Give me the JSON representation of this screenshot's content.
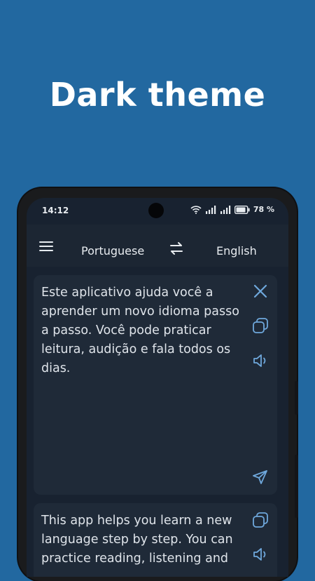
{
  "hero": {
    "title": "Dark theme"
  },
  "status_bar": {
    "time": "14:12",
    "battery": "78 %"
  },
  "app_bar": {
    "source_language": "Portuguese",
    "target_language": "English"
  },
  "source_card": {
    "text": "Este aplicativo ajuda você a aprender um novo idioma passo a passo. Você pode praticar leitura, audição e fala todos os dias."
  },
  "result_card": {
    "text": "This app helps you learn a new language step by step. You can practice reading, listening and"
  },
  "icons": {
    "clear": "close-icon",
    "copy": "copy-icon",
    "speak": "speaker-icon",
    "send": "send-icon",
    "swap": "swap-icon",
    "menu": "hamburger-menu-icon"
  },
  "colors": {
    "background": "#2268a0",
    "screen": "#182230",
    "card": "#1f2a38",
    "accent": "#6fa8dc"
  }
}
